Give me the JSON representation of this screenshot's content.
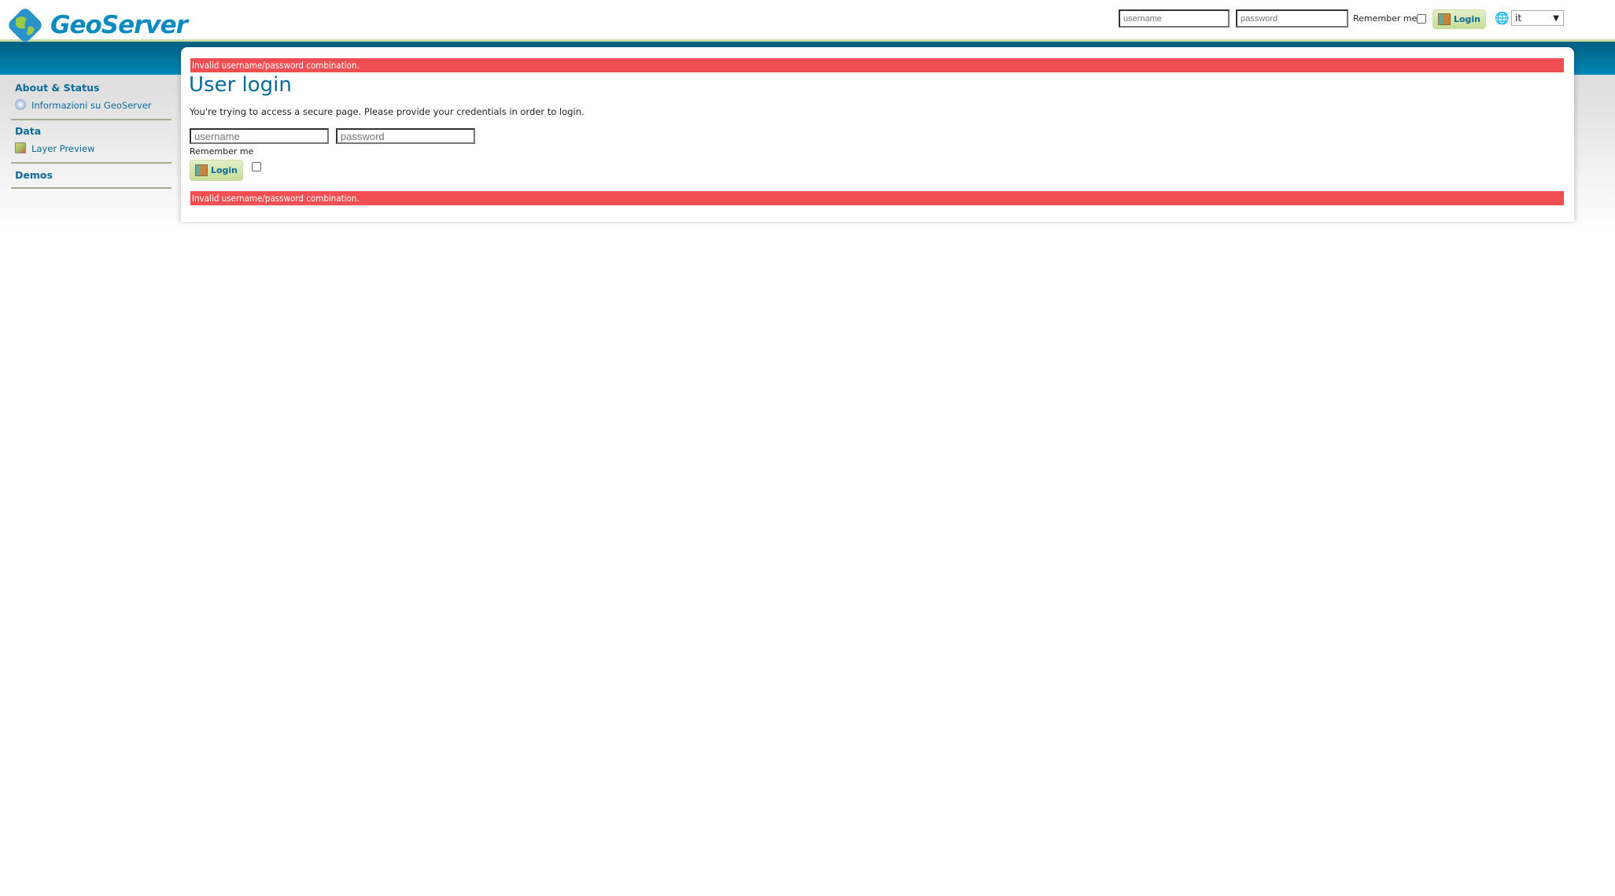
{
  "header": {
    "logo_text": "GeoServer",
    "username_placeholder": "username",
    "password_placeholder": "password",
    "remember_label": "Remember me",
    "login_label": "Login",
    "language": "it"
  },
  "sidebar": {
    "sections": [
      {
        "title": "About & Status",
        "items": [
          {
            "label": "Informazioni su GeoServer",
            "icon": "info-icon"
          }
        ]
      },
      {
        "title": "Data",
        "items": [
          {
            "label": "Layer Preview",
            "icon": "layer-preview-icon"
          }
        ]
      },
      {
        "title": "Demos",
        "items": []
      }
    ]
  },
  "main": {
    "error": "Invalid username/password combination.",
    "title": "User login",
    "description": "You're trying to access a secure page. Please provide your credentials in order to login.",
    "username_placeholder": "username",
    "password_placeholder": "password",
    "remember_label": "Remember me",
    "login_label": "Login"
  },
  "colors": {
    "accent": "#0a8bbf",
    "error": "#f04e52",
    "button": "#c6de96"
  }
}
